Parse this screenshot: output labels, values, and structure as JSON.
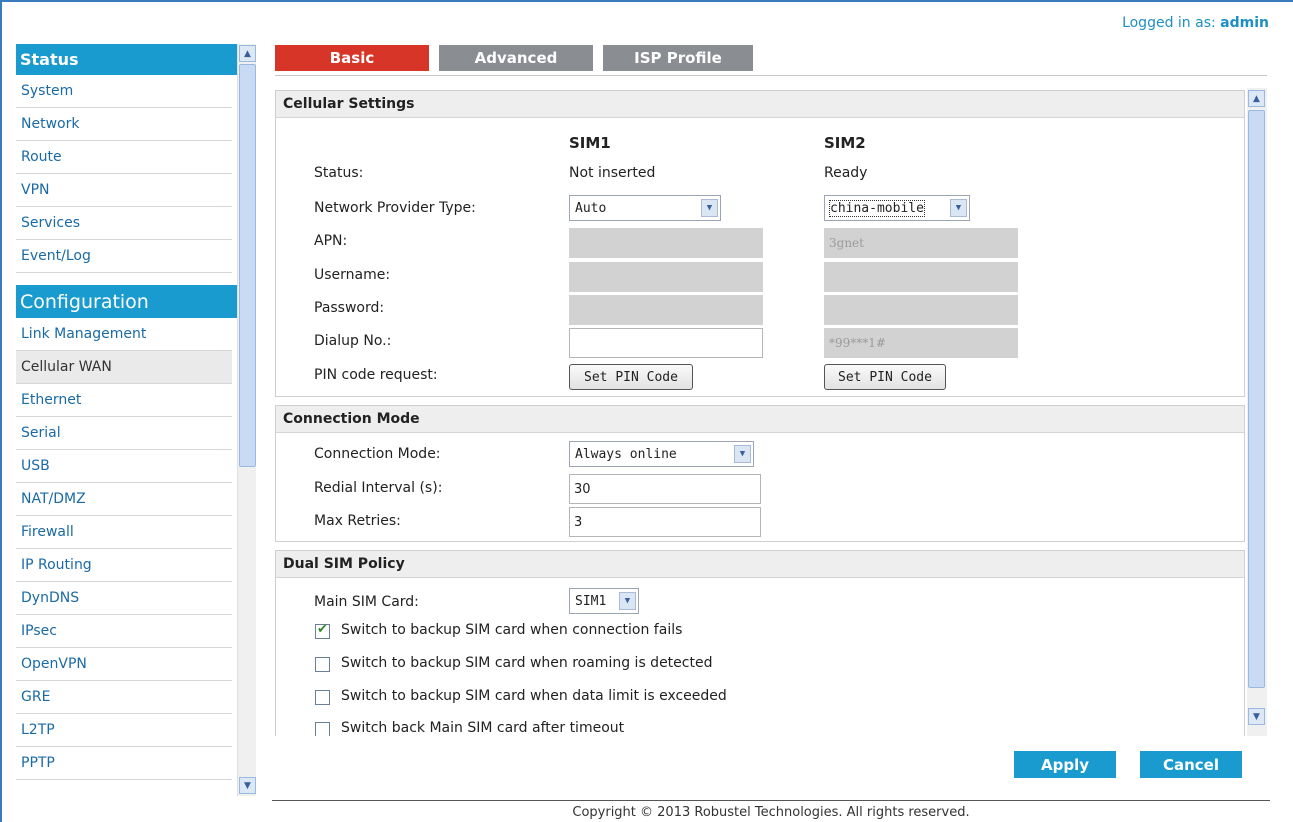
{
  "header": {
    "logged_in_label": "Logged in as:",
    "user": "admin"
  },
  "sidebar": {
    "status_title": "Status",
    "status_items": [
      "System",
      "Network",
      "Route",
      "VPN",
      "Services",
      "Event/Log"
    ],
    "config_title": "Configuration",
    "config_items": [
      "Link Management",
      "Cellular WAN",
      "Ethernet",
      "Serial",
      "USB",
      "NAT/DMZ",
      "Firewall",
      "IP Routing",
      "DynDNS",
      "IPsec",
      "OpenVPN",
      "GRE",
      "L2TP",
      "PPTP"
    ],
    "active_item": "Cellular WAN"
  },
  "tabs": {
    "basic": "Basic",
    "advanced": "Advanced",
    "isp": "ISP Profile",
    "active": "Basic"
  },
  "cellular": {
    "title": "Cellular Settings",
    "sim1_header": "SIM1",
    "sim2_header": "SIM2",
    "status_label": "Status:",
    "sim1_status": "Not inserted",
    "sim2_status": "Ready",
    "provider_label": "Network Provider Type:",
    "sim1_provider": "Auto",
    "sim2_provider": "china-mobile",
    "apn_label": "APN:",
    "sim1_apn": "",
    "sim2_apn": "3gnet",
    "username_label": "Username:",
    "sim1_username": "",
    "sim2_username": "",
    "password_label": "Password:",
    "sim1_password": "",
    "sim2_password": "",
    "dialup_label": "Dialup No.:",
    "sim1_dialup": "",
    "sim2_dialup": "*99***1#",
    "pin_label": "PIN code request:",
    "pin_button": "Set PIN Code"
  },
  "connection": {
    "title": "Connection Mode",
    "mode_label": "Connection Mode:",
    "mode_value": "Always online",
    "redial_label": "Redial Interval (s):",
    "redial_value": "30",
    "retries_label": "Max Retries:",
    "retries_value": "3"
  },
  "dual_sim": {
    "title": "Dual SIM Policy",
    "main_label": "Main SIM Card:",
    "main_value": "SIM1",
    "options": [
      {
        "label": "Switch to backup SIM card when connection fails",
        "checked": true
      },
      {
        "label": "Switch to backup SIM card when roaming is detected",
        "checked": false
      },
      {
        "label": "Switch to backup SIM card when data limit is exceeded",
        "checked": false
      },
      {
        "label": "Switch back Main SIM card after timeout",
        "checked": false
      }
    ]
  },
  "actions": {
    "apply": "Apply",
    "cancel": "Cancel"
  },
  "footer": {
    "copyright": "Copyright © 2013 Robustel Technologies. All rights reserved."
  }
}
